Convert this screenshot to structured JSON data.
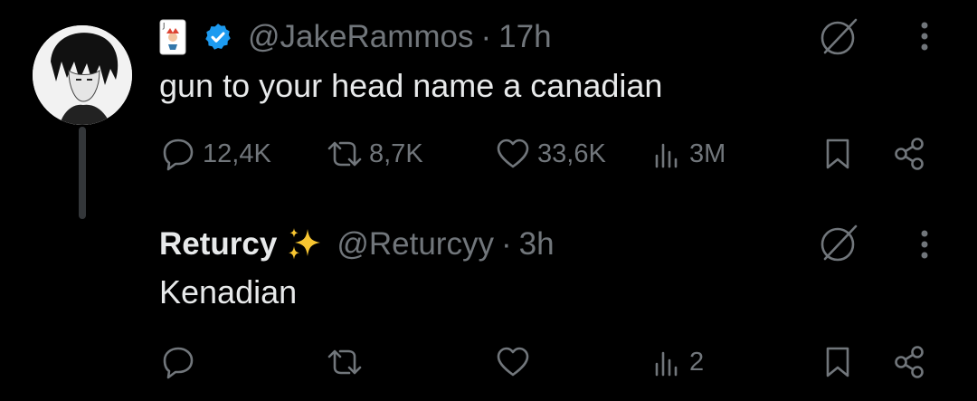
{
  "tweet": {
    "handle": "@JakeRammos",
    "separator": "·",
    "time": "17h",
    "text": "gun to your head name a canadian",
    "stats": {
      "replies": "12,4K",
      "retweets": "8,7K",
      "likes": "33,6K",
      "views": "3M"
    }
  },
  "reply": {
    "name": "Returcy",
    "handle": "@Returcyy",
    "separator": "·",
    "time": "3h",
    "text": "Kenadian",
    "stats": {
      "views": "2"
    }
  },
  "colors": {
    "background": "#000000",
    "text": "#e7e9ea",
    "muted": "#71767b",
    "verified": "#1d9bf0",
    "thread_line": "#333639"
  }
}
